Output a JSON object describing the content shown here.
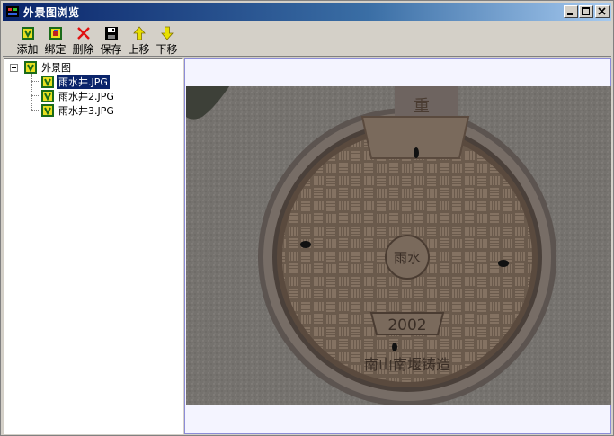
{
  "window": {
    "title": "外景图浏览"
  },
  "toolbar": {
    "buttons": [
      {
        "label": "添加",
        "icon": "add-icon"
      },
      {
        "label": "绑定",
        "icon": "bind-icon"
      },
      {
        "label": "删除",
        "icon": "delete-icon"
      },
      {
        "label": "保存",
        "icon": "save-icon"
      },
      {
        "label": "上移",
        "icon": "arrow-up-icon"
      },
      {
        "label": "下移",
        "icon": "arrow-down-icon"
      }
    ]
  },
  "tree": {
    "root": "外景图",
    "items": [
      "雨水井.JPG",
      "雨水井2.JPG",
      "雨水井3.JPG"
    ],
    "selected_index": 0
  },
  "photo": {
    "cover_top_text": "重",
    "cover_center_text": "雨水",
    "cover_year": "2002",
    "cover_bottom_text": "南山南堰铸造"
  },
  "colors": {
    "titlebar_start": "#0a246a",
    "titlebar_end": "#a6caf0",
    "selection": "#0a246a",
    "face": "#d4d0c8"
  }
}
